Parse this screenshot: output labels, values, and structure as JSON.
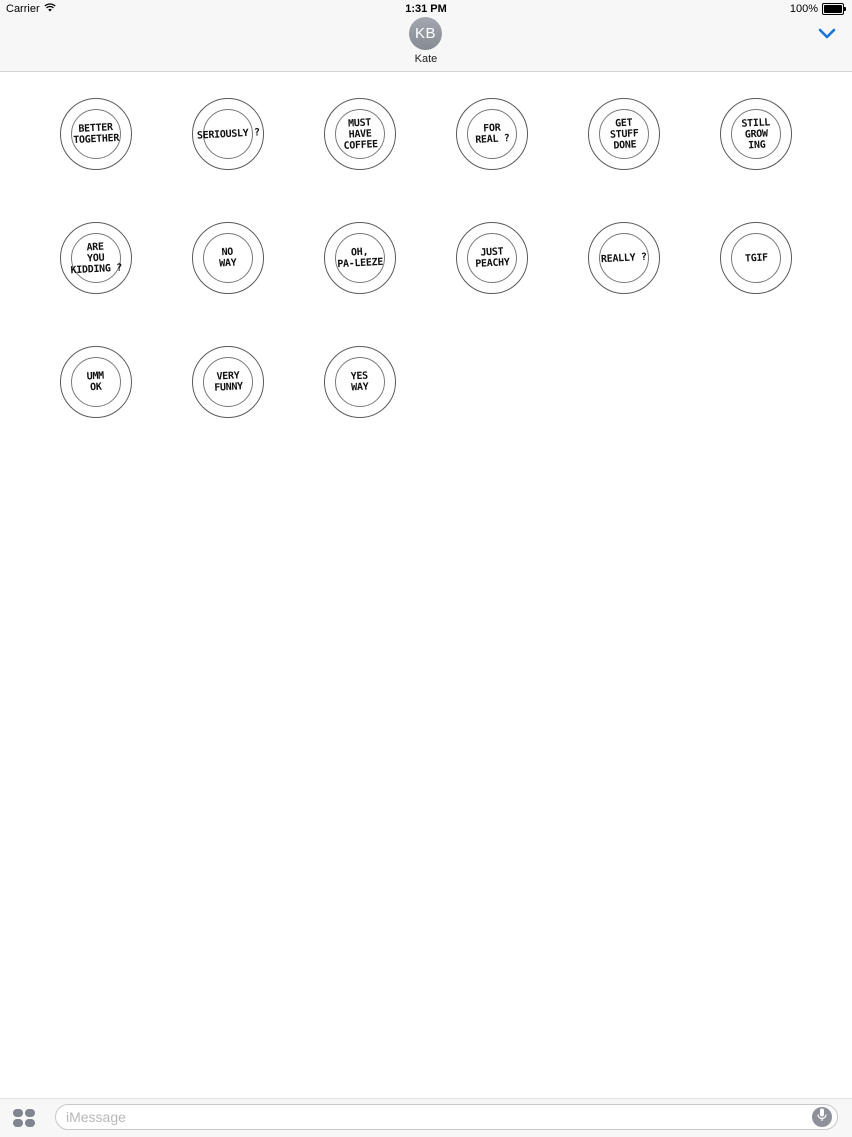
{
  "status_bar": {
    "carrier": "Carrier",
    "time": "1:31 PM",
    "battery_percent": "100%",
    "battery_level": 1.0
  },
  "header": {
    "avatar_initials": "KB",
    "contact_name": "Kate",
    "collapse_icon": "chevron-down-icon",
    "accent_color": "#1a73d9"
  },
  "stickers": [
    {
      "text": "BETTER\nTOGETHER"
    },
    {
      "text": "SERIOUSLY ?"
    },
    {
      "text": "MUST\nHAVE\nCOFFEE"
    },
    {
      "text": "FOR\nREAL ?"
    },
    {
      "text": "GET\nSTUFF\nDONE"
    },
    {
      "text": "STILL\nGROW\nING"
    },
    {
      "text": "ARE\nYOU\nKIDDING ?"
    },
    {
      "text": "NO\nWAY"
    },
    {
      "text": "OH,\nPA-LEEZE"
    },
    {
      "text": "JUST\nPEACHY"
    },
    {
      "text": "REALLY ?"
    },
    {
      "text": "TGIF"
    },
    {
      "text": "UMM\nOK"
    },
    {
      "text": "VERY\nFUNNY"
    },
    {
      "text": "YES\nWAY"
    }
  ],
  "input_bar": {
    "placeholder": "iMessage",
    "value": "",
    "apps_icon": "app-drawer-icon",
    "mic_icon": "microphone-icon"
  }
}
